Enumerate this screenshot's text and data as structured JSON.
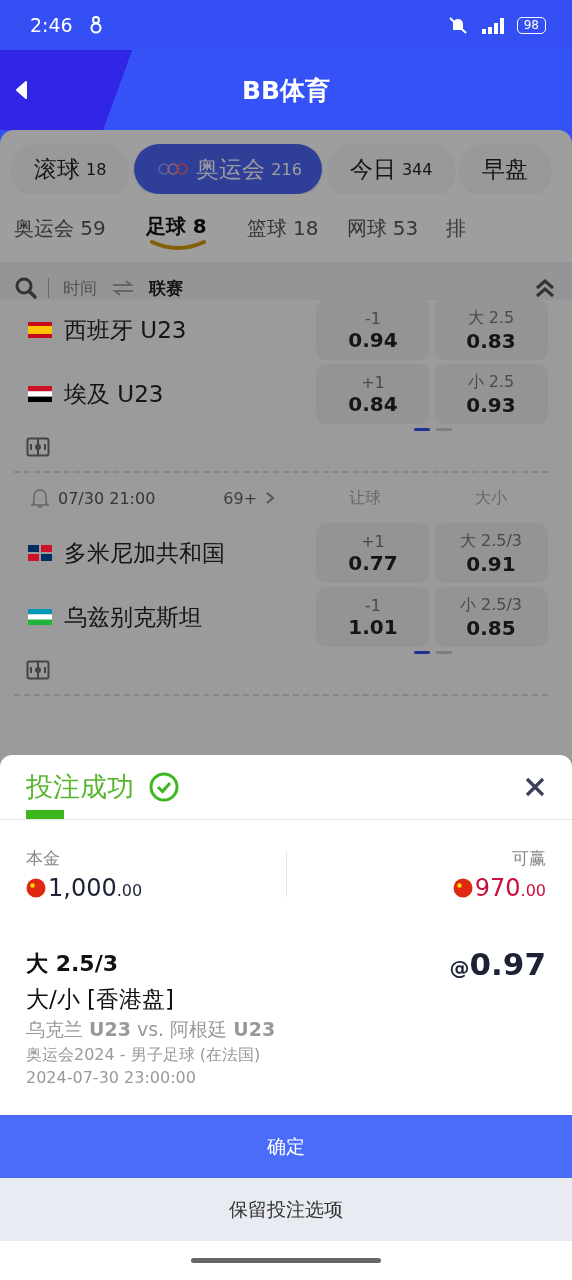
{
  "status_bar": {
    "time": "2:46",
    "battery": "98"
  },
  "header": {
    "title": "BB体育"
  },
  "market_tabs": [
    {
      "label": "滚球",
      "count": "18",
      "selected": false,
      "logo": false
    },
    {
      "label": "奥运会",
      "count": "216",
      "selected": true,
      "logo": true
    },
    {
      "label": "今日",
      "count": "344",
      "selected": false,
      "logo": false
    },
    {
      "label": "早盘",
      "selected": false,
      "logo": false
    }
  ],
  "sport_tabs": [
    {
      "label": "奥运会 59",
      "selected": false
    },
    {
      "label": "足球 8",
      "selected": true
    },
    {
      "label": "篮球 18",
      "selected": false
    },
    {
      "label": "网球 53",
      "selected": false
    },
    {
      "label": "排",
      "selected": false
    }
  ],
  "filter": {
    "options": [
      {
        "label": "时间",
        "selected": false
      },
      {
        "label": "联赛",
        "selected": true
      }
    ]
  },
  "matches": [
    {
      "teams": [
        {
          "name": "西班牙 U23",
          "flag": {
            "kind": "stripes",
            "parts": [
              {
                "color": "#c60b1e"
              },
              {
                "color": "#ffc400"
              },
              {
                "color": "#ffc400"
              },
              {
                "color": "#c60b1e"
              }
            ]
          },
          "odds": [
            {
              "line": "-1",
              "price": "0.94"
            },
            {
              "line": "大 2.5",
              "price": "0.83"
            }
          ]
        },
        {
          "name": "埃及 U23",
          "flag": {
            "kind": "stripes",
            "parts": [
              {
                "color": "#ce1126"
              },
              {
                "color": "#ffffff"
              },
              {
                "color": "#000000"
              }
            ]
          },
          "odds": [
            {
              "line": "+1",
              "price": "0.84"
            },
            {
              "line": "小 2.5",
              "price": "0.93"
            }
          ]
        }
      ],
      "pages": [
        {
          "selected": true
        },
        {
          "selected": false
        }
      ]
    },
    {
      "time": "07/30 21:00",
      "more": "69+",
      "columns": [
        "让球",
        "大小"
      ],
      "teams": [
        {
          "name": "多米尼加共和国",
          "flag": {
            "kind": "quarters",
            "parts": [
              {
                "color": "#002d62"
              },
              {
                "color": "#ce1126"
              },
              {
                "color": "#ce1126"
              },
              {
                "color": "#002d62"
              }
            ]
          },
          "odds": [
            {
              "line": "+1",
              "price": "0.77"
            },
            {
              "line": "大 2.5/3",
              "price": "0.91"
            }
          ]
        },
        {
          "name": "乌兹别克斯坦",
          "flag": {
            "kind": "stripes",
            "parts": [
              {
                "color": "#0099b5"
              },
              {
                "color": "#ffffff"
              },
              {
                "color": "#1eb53a"
              }
            ]
          },
          "odds": [
            {
              "line": "-1",
              "price": "1.01"
            },
            {
              "line": "小 2.5/3",
              "price": "0.85"
            }
          ]
        }
      ],
      "pages": [
        {
          "selected": true
        },
        {
          "selected": false
        }
      ]
    }
  ],
  "bet_slip": {
    "title": "投注成功",
    "stake": {
      "label": "本金",
      "amount": "1,000",
      "decimals": ".00"
    },
    "payout": {
      "label": "可赢",
      "amount": "970",
      "decimals": ".00"
    },
    "selection": "大 2.5/3",
    "odds_prefix": "@",
    "odds": "0.97",
    "market": "大/小 [香港盘]",
    "match": "乌克兰 **U23** vs. 阿根廷 **U23**",
    "league": "奥运会2024 - 男子足球 (在法国)",
    "datetime": "2024-07-30 23:00:00",
    "buttons": [
      {
        "label": "确定",
        "kind": "primary"
      },
      {
        "label": "保留投注选项",
        "kind": "secondary"
      }
    ]
  }
}
